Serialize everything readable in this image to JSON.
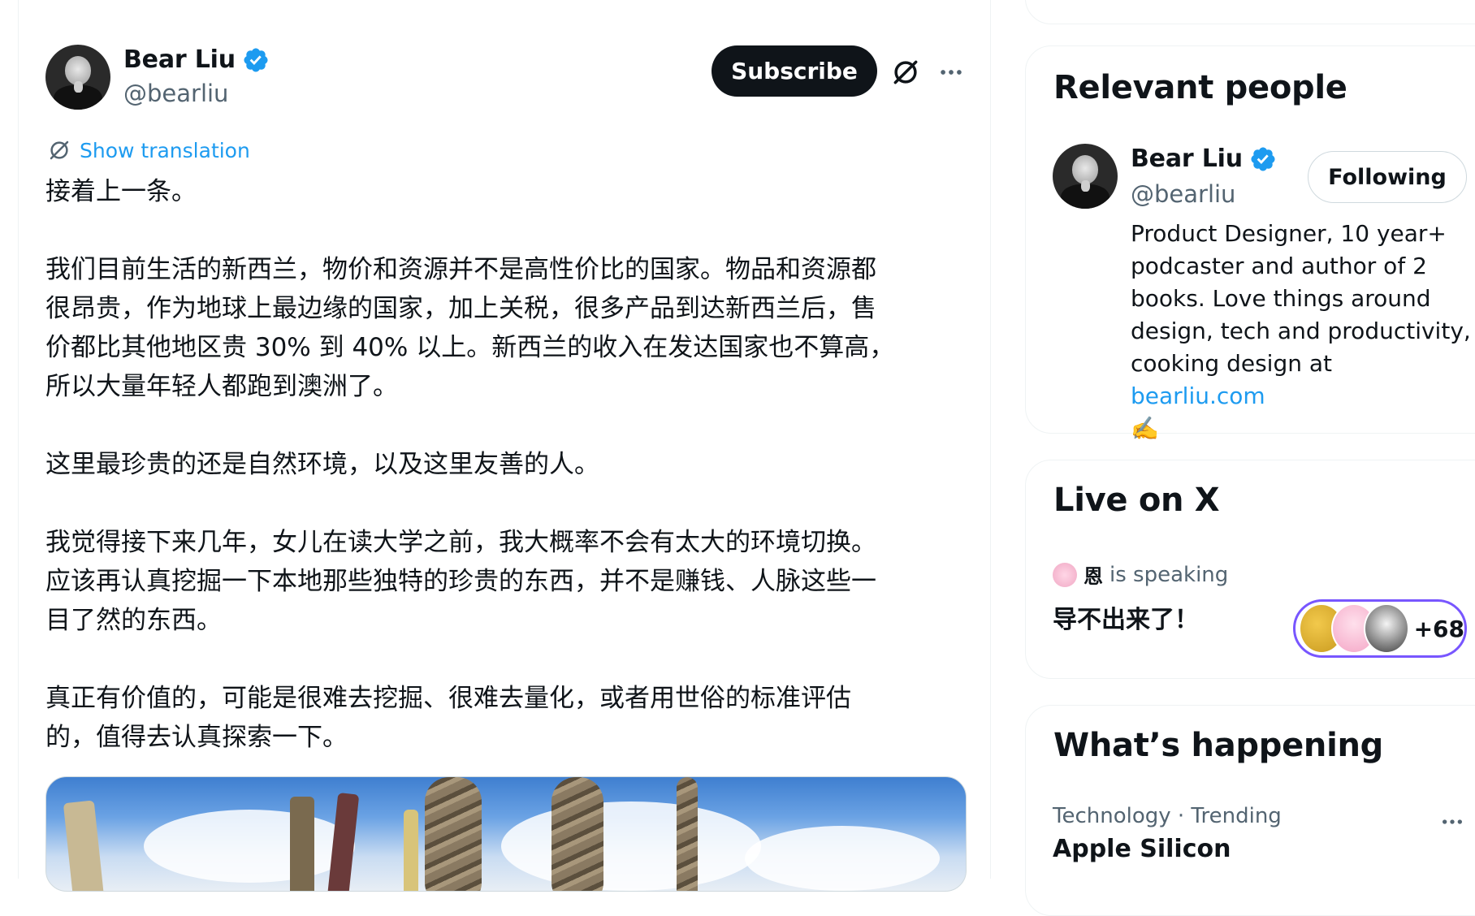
{
  "post": {
    "author_name": "Bear Liu",
    "author_handle": "@bearliu",
    "subscribe_label": "Subscribe",
    "show_translation": "Show translation",
    "text": "接着上一条。\n\n我们目前生活的新西兰，物价和资源并不是高性价比的国家。物品和资源都\n很昂贵，作为地球上最边缘的国家，加上关税，很多产品到达新西兰后，售\n价都比其他地区贵 30% 到 40% 以上。新西兰的收入在发达国家也不算高，\n所以大量年轻人都跑到澳洲了。\n\n这里最珍贵的还是自然环境，以及这里友善的人。\n\n我觉得接下来几年，女儿在读大学之前，我大概率不会有太大的环境切换。\n应该再认真挖掘一下本地那些独特的珍贵的东西，并不是赚钱、人脉这些一\n目了然的东西。\n\n真正有价值的，可能是很难去挖掘、很难去量化，或者用世俗的标准评估\n的，值得去认真探索一下。"
  },
  "relevant_people": {
    "title": "Relevant people",
    "person": {
      "name": "Bear Liu",
      "handle": "@bearliu",
      "follow_label": "Following",
      "bio_text": "Product Designer, 10 year+ podcaster and author of 2 books. Love things around design, tech and productivity, cooking design at ",
      "bio_link": "bearliu.com",
      "bio_emoji": "✍️"
    }
  },
  "live": {
    "title": "Live on X",
    "speaker_name": "恩",
    "speaker_status": "is speaking",
    "space_title": "导不出来了！",
    "listener_count": "+68"
  },
  "happening": {
    "title": "What’s happening",
    "trend_meta": "Technology · Trending",
    "trend_name": "Apple Silicon"
  },
  "colors": {
    "accent": "#1d9bf0",
    "live_ring": "#7856ff",
    "text_primary": "#0f1419",
    "text_secondary": "#536471"
  }
}
